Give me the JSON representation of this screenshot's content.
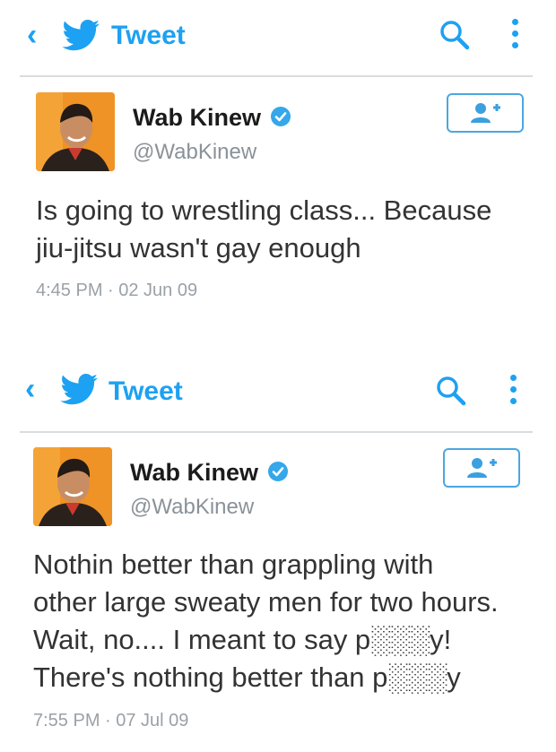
{
  "tweets": [
    {
      "bar_title": "Tweet",
      "name": "Wab Kinew",
      "handle": "@WabKinew",
      "text_lines": [
        "Is going to wrestling class... Because",
        "jiu-jitsu wasn't gay enough"
      ],
      "time": "4:45 PM · 02 Jun 09"
    },
    {
      "bar_title": "Tweet",
      "name": "Wab Kinew",
      "handle": "@WabKinew",
      "text_lines": [
        "Nothin better than grappling with",
        "other large sweaty men for two hours.",
        "Wait, no.... I meant to say p░░░y!",
        "There's nothing better than p░░░y"
      ],
      "time": "7:55 PM · 07 Jul 09"
    }
  ],
  "icons": {
    "back": "chevron-left-icon",
    "logo": "twitter-bird-icon",
    "search": "search-icon",
    "more": "vertical-dots-icon",
    "verified": "verified-badge-icon",
    "follow": "add-user-icon"
  },
  "colors": {
    "accent": "#1da1f2",
    "name": "#1b1b1b",
    "secondary": "#8a9299",
    "text": "#333333",
    "divider": "#d9dde0"
  }
}
